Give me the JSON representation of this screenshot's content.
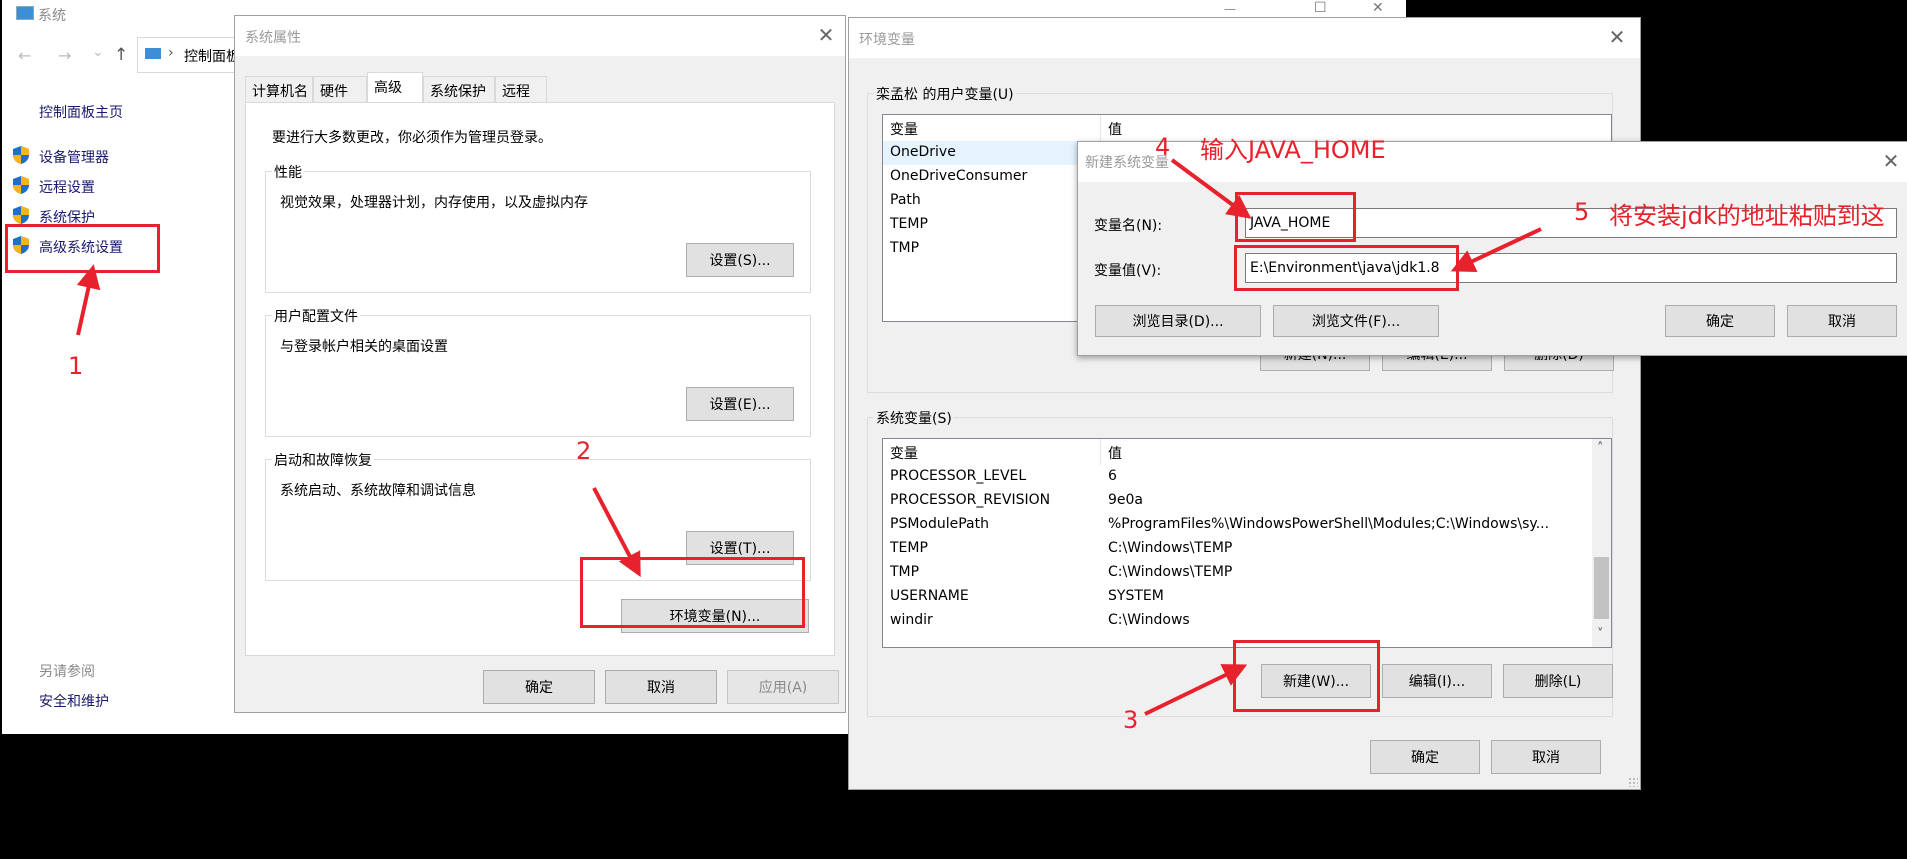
{
  "system_window": {
    "title": "系统",
    "nav": {
      "back": "←",
      "forward": "→",
      "recent": "⌄",
      "up": "↑",
      "chevron": "›",
      "address": "控制面板"
    },
    "controls": {
      "minimize": "—",
      "maximize": "☐",
      "close": "✕"
    },
    "sidebar": {
      "home": "控制面板主页",
      "items": [
        {
          "label": "设备管理器",
          "icon": "uac-shield-icon"
        },
        {
          "label": "远程设置",
          "icon": "uac-shield-icon"
        },
        {
          "label": "系统保护",
          "icon": "uac-shield-icon"
        },
        {
          "label": "高级系统设置",
          "icon": "uac-shield-icon"
        }
      ],
      "see_also_label": "另请参阅",
      "see_also_items": [
        "安全和维护"
      ]
    }
  },
  "system_properties": {
    "title": "系统属性",
    "close": "✕",
    "tabs": [
      {
        "label": "计算机名",
        "active": false
      },
      {
        "label": "硬件",
        "active": false
      },
      {
        "label": "高级",
        "active": true
      },
      {
        "label": "系统保护",
        "active": false
      },
      {
        "label": "远程",
        "active": false
      }
    ],
    "admin_note": "要进行大多数更改，你必须作为管理员登录。",
    "groups": [
      {
        "label": "性能",
        "desc": "视觉效果，处理器计划，内存使用，以及虚拟内存",
        "button": "设置(S)..."
      },
      {
        "label": "用户配置文件",
        "desc": "与登录帐户相关的桌面设置",
        "button": "设置(E)..."
      },
      {
        "label": "启动和故障恢复",
        "desc": "系统启动、系统故障和调试信息",
        "button": "设置(T)..."
      }
    ],
    "env_button": "环境变量(N)...",
    "ok": "确定",
    "cancel": "取消",
    "apply": "应用(A)"
  },
  "env_vars": {
    "title": "环境变量",
    "close": "✕",
    "user_group_label": "栾孟松 的用户变量(U)",
    "columns": [
      "变量",
      "值"
    ],
    "user_vars": [
      {
        "name": "OneDrive",
        "value": "",
        "selected": true
      },
      {
        "name": "OneDriveConsumer",
        "value": ""
      },
      {
        "name": "Path",
        "value": ""
      },
      {
        "name": "TEMP",
        "value": ""
      },
      {
        "name": "TMP",
        "value": ""
      }
    ],
    "user_buttons": {
      "new": "新建(N)...",
      "edit": "编辑(E)...",
      "delete": "删除(D)"
    },
    "system_group_label": "系统变量(S)",
    "system_vars": [
      {
        "name": "PROCESSOR_LEVEL",
        "value": "6"
      },
      {
        "name": "PROCESSOR_REVISION",
        "value": "9e0a"
      },
      {
        "name": "PSModulePath",
        "value": "%ProgramFiles%\\WindowsPowerShell\\Modules;C:\\Windows\\sy..."
      },
      {
        "name": "TEMP",
        "value": "C:\\Windows\\TEMP"
      },
      {
        "name": "TMP",
        "value": "C:\\Windows\\TEMP"
      },
      {
        "name": "USERNAME",
        "value": "SYSTEM"
      },
      {
        "name": "windir",
        "value": "C:\\Windows"
      }
    ],
    "system_buttons": {
      "new": "新建(W)...",
      "edit": "编辑(I)...",
      "delete": "删除(L)"
    },
    "scroll_up": "˄",
    "scroll_down": "˅",
    "ok": "确定",
    "cancel": "取消"
  },
  "new_var_dialog": {
    "title": "新建系统变量",
    "close": "✕",
    "name_label": "变量名(N):",
    "name_value": "JAVA_HOME",
    "value_label": "变量值(V):",
    "value_value": "E:\\Environment\\java\\jdk1.8",
    "browse_dir": "浏览目录(D)...",
    "browse_file": "浏览文件(F)...",
    "ok": "确定",
    "cancel": "取消"
  },
  "annotations": {
    "color": "#e8222c",
    "step1": "1",
    "step2": "2",
    "step3": "3",
    "step4": "4",
    "step4_text": "输入JAVA_HOME",
    "step5": "5",
    "step5_text": "将安装jdk的地址粘贴到这"
  }
}
